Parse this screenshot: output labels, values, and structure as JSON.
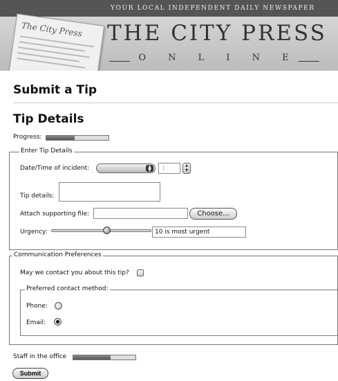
{
  "masthead": {
    "tagline": "YOUR LOCAL INDEPENDENT DAILY NEWSPAPER",
    "logo": "THE CITY PRESS",
    "paper_title": "The City Press",
    "subtitle": "O N L I N E"
  },
  "page": {
    "title": "Submit a Tip",
    "section_title": "Tip Details"
  },
  "progress": {
    "label": "Progress:",
    "value": 0.45
  },
  "tip_fieldset": {
    "legend": "Enter Tip Details",
    "datetime_label": "Date/Time of incident:",
    "time_value": ":",
    "details_label": "Tip details:",
    "file_label": "Attach supporting file:",
    "choose_label": "Choose...",
    "urgency_label": "Urgency:",
    "urgency_value": 0.55,
    "urgency_hint": "10 is most urgent"
  },
  "comm_fieldset": {
    "legend": "Communication Preferences",
    "contact_question": "May we contact you about this tip?",
    "contact_checked": false,
    "method_fieldset": {
      "legend": "Preferred contact method:",
      "options": [
        {
          "label": "Phone:",
          "selected": false
        },
        {
          "label": "Email:",
          "selected": true
        }
      ]
    }
  },
  "staff": {
    "label": "Staff in the office",
    "value": 0.6
  },
  "submit_label": "Submit"
}
